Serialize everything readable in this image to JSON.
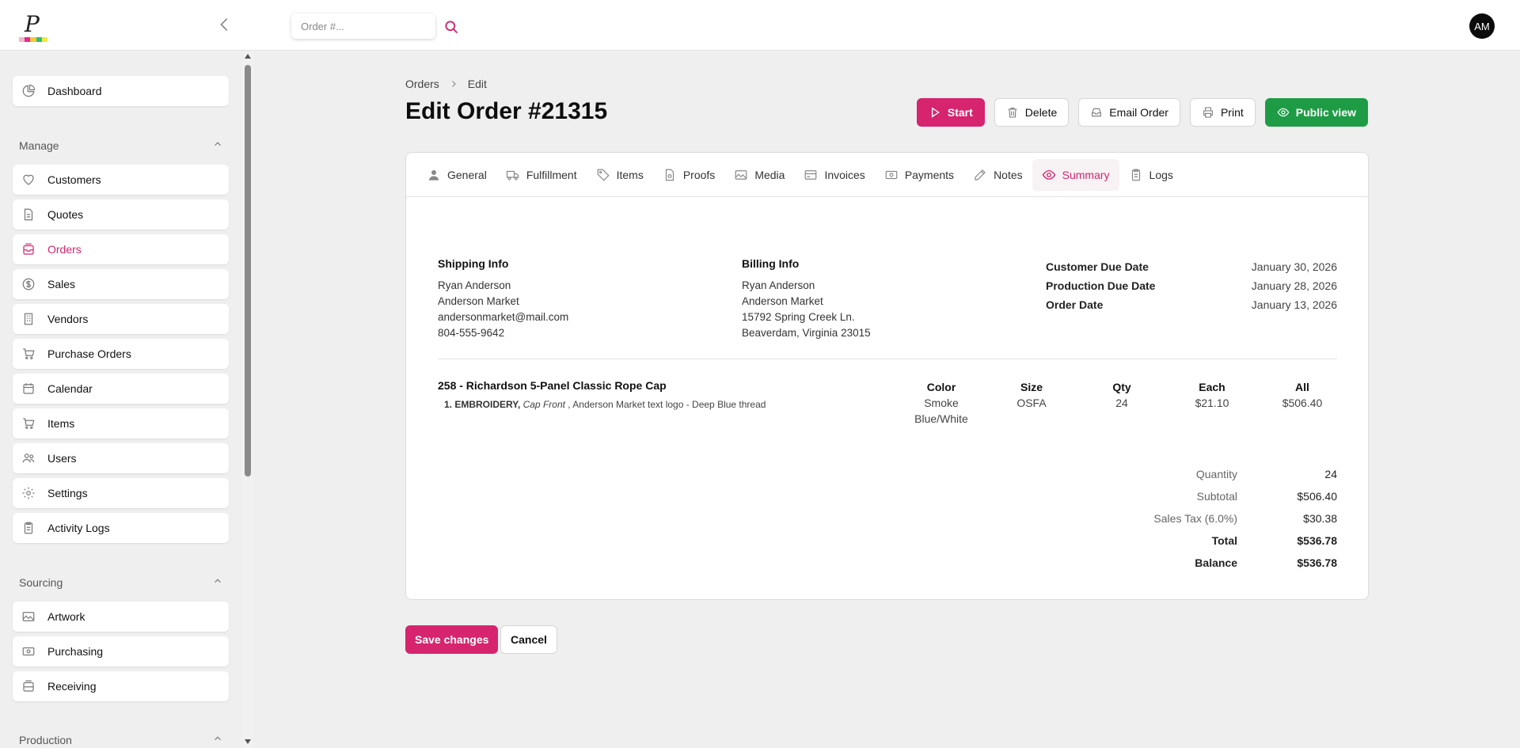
{
  "app": {
    "search": {
      "placeholder": "Order #..."
    },
    "avatar_initials": "AM",
    "brand_colors": {
      "accent": "#d6246e",
      "success": "#1e9c45"
    }
  },
  "sidebar": {
    "dashboard": {
      "label": "Dashboard",
      "icon": "dashboard-icon"
    },
    "sections": [
      {
        "title": "Manage"
      },
      {
        "title": "Sourcing"
      },
      {
        "title": "Production"
      }
    ],
    "manage_items": [
      {
        "label": "Customers",
        "icon": "heart-icon"
      },
      {
        "label": "Quotes",
        "icon": "document-icon"
      },
      {
        "label": "Orders",
        "icon": "inbox-icon",
        "active": true
      },
      {
        "label": "Sales",
        "icon": "dollar-icon"
      },
      {
        "label": "Vendors",
        "icon": "building-icon"
      },
      {
        "label": "Purchase Orders",
        "icon": "cart-icon"
      },
      {
        "label": "Calendar",
        "icon": "calendar-icon"
      },
      {
        "label": "Items",
        "icon": "cart-icon"
      },
      {
        "label": "Users",
        "icon": "users-icon"
      },
      {
        "label": "Settings",
        "icon": "gear-icon"
      },
      {
        "label": "Activity Logs",
        "icon": "clipboard-icon"
      }
    ],
    "sourcing_items": [
      {
        "label": "Artwork",
        "icon": "image-icon"
      },
      {
        "label": "Purchasing",
        "icon": "cash-icon"
      },
      {
        "label": "Receiving",
        "icon": "box-icon"
      }
    ]
  },
  "breadcrumb": {
    "root": "Orders",
    "current": "Edit"
  },
  "page": {
    "title": "Edit Order #21315"
  },
  "actions": {
    "start": "Start",
    "delete": "Delete",
    "email": "Email Order",
    "print": "Print",
    "public_view": "Public view"
  },
  "tabs": [
    {
      "label": "General",
      "icon": "person-icon"
    },
    {
      "label": "Fulfillment",
      "icon": "truck-icon"
    },
    {
      "label": "Items",
      "icon": "tag-icon"
    },
    {
      "label": "Proofs",
      "icon": "file-check-icon"
    },
    {
      "label": "Media",
      "icon": "image-icon"
    },
    {
      "label": "Invoices",
      "icon": "credit-card-icon"
    },
    {
      "label": "Payments",
      "icon": "cash-icon"
    },
    {
      "label": "Notes",
      "icon": "pencil-icon"
    },
    {
      "label": "Summary",
      "icon": "eye-icon",
      "active": true
    },
    {
      "label": "Logs",
      "icon": "clipboard-icon"
    }
  ],
  "shipping": {
    "title": "Shipping Info",
    "name": "Ryan Anderson",
    "company": "Anderson Market",
    "email": "andersonmarket@mail.com",
    "phone": "804-555-9642"
  },
  "billing": {
    "title": "Billing Info",
    "name": "Ryan Anderson",
    "company": "Anderson Market",
    "street": "15792 Spring Creek Ln.",
    "city": "Beaverdam, Virginia 23015"
  },
  "dates": [
    {
      "label": "Customer Due Date",
      "value": "January 30, 2026"
    },
    {
      "label": "Production Due Date",
      "value": "January 28, 2026"
    },
    {
      "label": "Order Date",
      "value": "January 13, 2026"
    }
  ],
  "line_item": {
    "title": "258 - Richardson 5-Panel Classic Rope Cap",
    "decoration_prefix": "1. EMBROIDERY,",
    "decoration_location": "Cap Front",
    "decoration_detail": ", Anderson Market text logo - Deep Blue thread",
    "headers": {
      "color": "Color",
      "size": "Size",
      "qty": "Qty",
      "each": "Each",
      "all": "All"
    },
    "values": {
      "color_line1": "Smoke",
      "color_line2": "Blue/White",
      "size": "OSFA",
      "qty": "24",
      "each": "$21.10",
      "all": "$506.40"
    }
  },
  "totals": [
    {
      "label": "Quantity",
      "value": "24"
    },
    {
      "label": "Subtotal",
      "value": "$506.40"
    },
    {
      "label": "Sales Tax (6.0%)",
      "value": "$30.38"
    },
    {
      "label": "Total",
      "value": "$536.78",
      "bold": true
    },
    {
      "label": "Balance",
      "value": "$536.78",
      "bold": true
    }
  ],
  "footer": {
    "save": "Save changes",
    "cancel": "Cancel"
  }
}
